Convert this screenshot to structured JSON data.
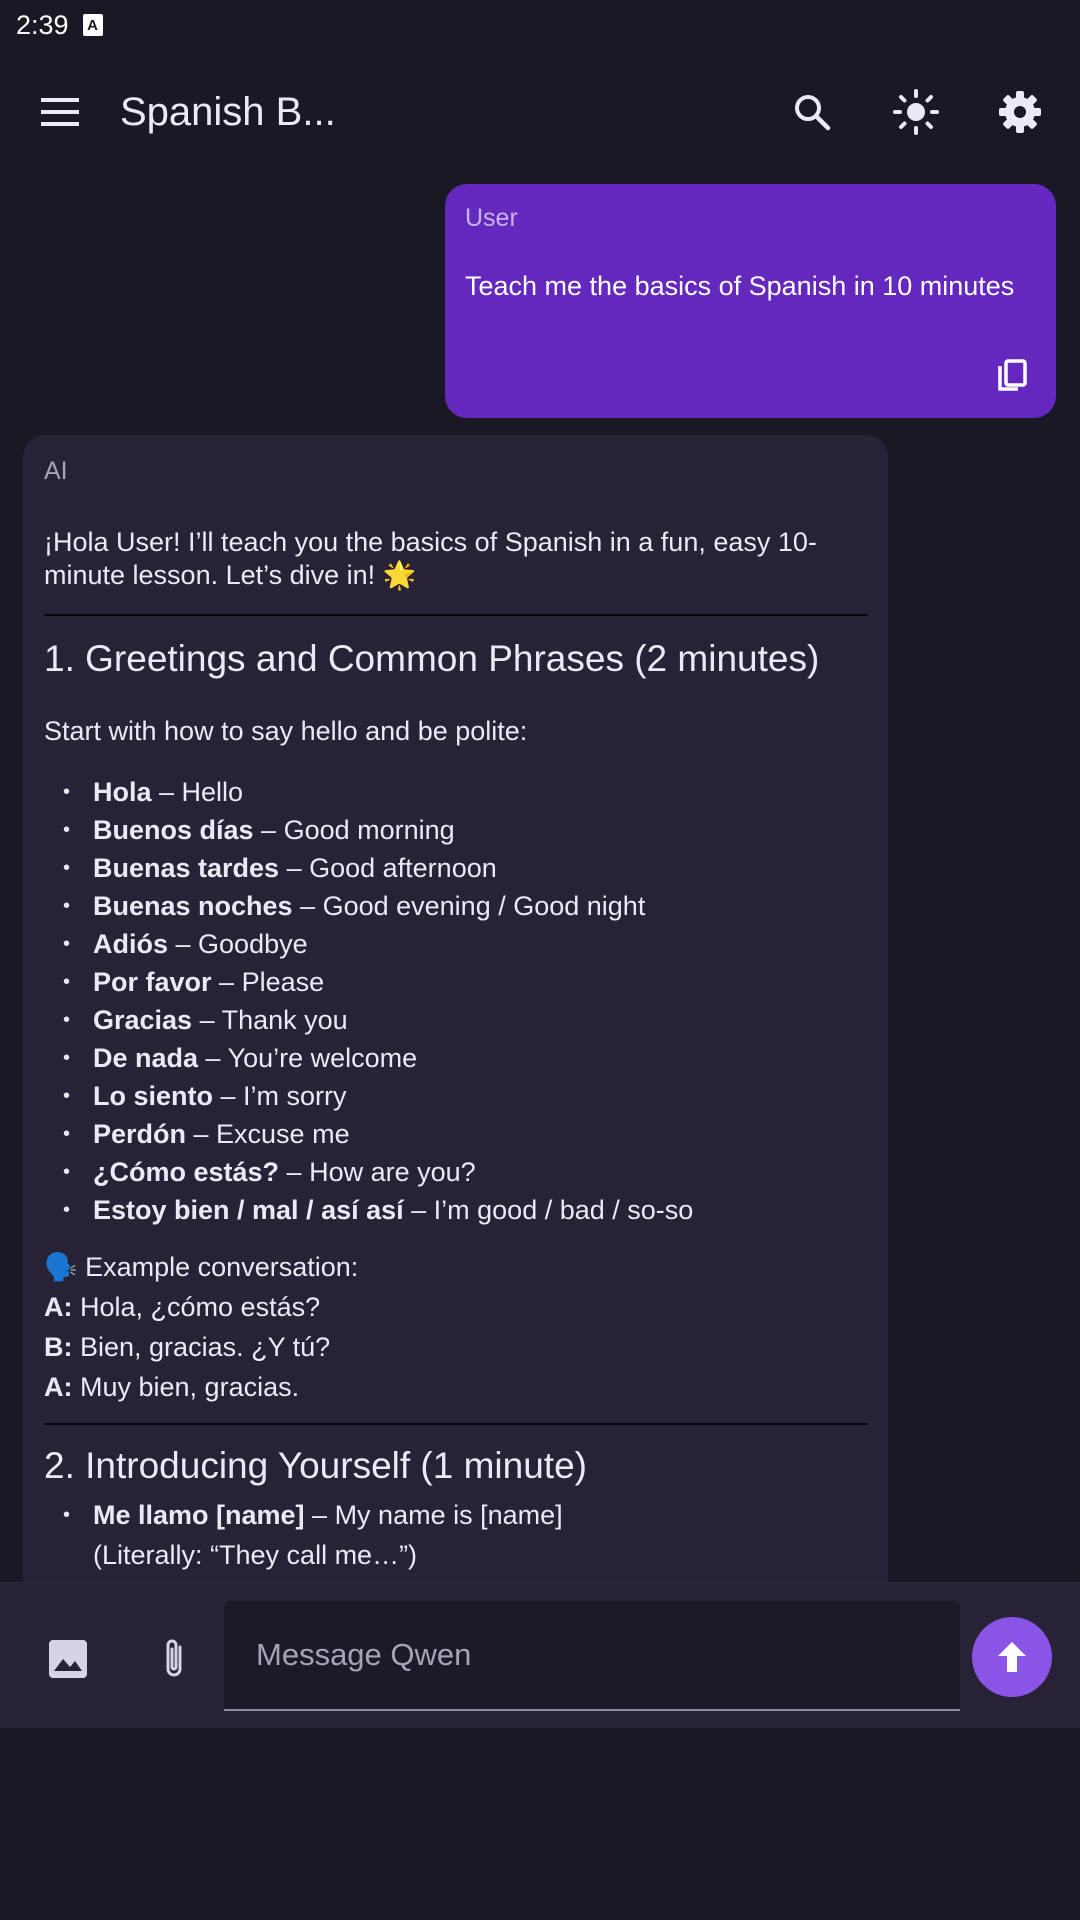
{
  "status": {
    "time": "2:39",
    "notification_icon": "A"
  },
  "header": {
    "title": "Spanish B...",
    "icons": [
      "menu-icon",
      "search-icon",
      "brightness-icon",
      "gear-icon"
    ]
  },
  "messages": {
    "user": {
      "sender": "User",
      "text": "Teach me the basics of Spanish in 10 minutes"
    },
    "ai": {
      "sender": "AI",
      "intro": "¡Hola User! I’ll teach you the basics of Spanish in a fun, easy 10-minute lesson. Let’s dive in! 🌟",
      "section1": {
        "heading": "1. Greetings and Common Phrases (2 minutes)",
        "subtext": "Start with how to say hello and be polite:",
        "phrases": [
          {
            "es": "Hola",
            "en": " – Hello"
          },
          {
            "es": "Buenos días",
            "en": " – Good morning"
          },
          {
            "es": "Buenas tardes",
            "en": " – Good afternoon"
          },
          {
            "es": "Buenas noches",
            "en": " – Good evening / Good night"
          },
          {
            "es": "Adiós",
            "en": " – Goodbye"
          },
          {
            "es": "Por favor",
            "en": " – Please"
          },
          {
            "es": "Gracias",
            "en": " – Thank you"
          },
          {
            "es": "De nada",
            "en": " – You’re welcome"
          },
          {
            "es": "Lo siento",
            "en": " – I’m sorry"
          },
          {
            "es": "Perdón",
            "en": " – Excuse me"
          },
          {
            "es": "¿Cómo estás?",
            "en": " – How are you?"
          },
          {
            "es": "Estoy bien / mal / así así",
            "en": " – I’m good / bad / so-so"
          }
        ],
        "example_title": "🗣️ Example conversation:",
        "example_lines": [
          {
            "speaker": "A:",
            "text": " Hola, ¿cómo estás?"
          },
          {
            "speaker": "B:",
            "text": " Bien, gracias. ¿Y tú?"
          },
          {
            "speaker": "A:",
            "text": " Muy bien, gracias."
          }
        ]
      },
      "section2": {
        "heading": "2. Introducing Yourself (1 minute)",
        "item_es": "Me llamo [name]",
        "item_en": " – My name is [name]",
        "item_note": "(Literally: “They call me…”)"
      }
    }
  },
  "composer": {
    "placeholder": "Message Qwen"
  },
  "colors": {
    "background": "#1b1825",
    "user_bubble": "#6428be",
    "ai_bubble": "#272236",
    "accent": "#8a55e6"
  }
}
